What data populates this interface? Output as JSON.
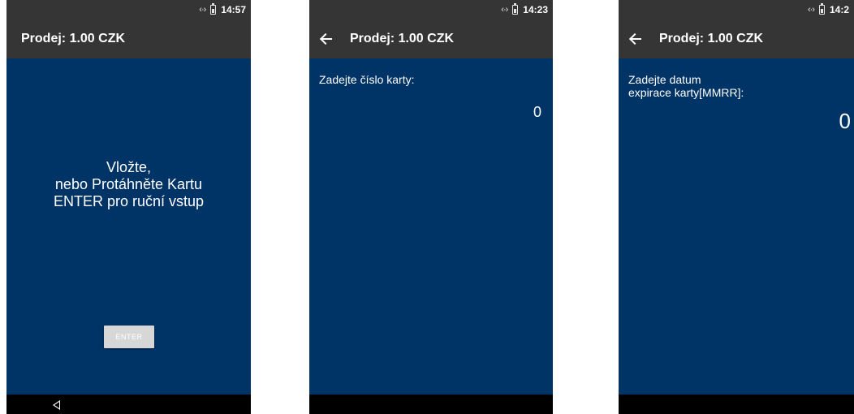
{
  "screens": [
    {
      "status": {
        "time": "14:57"
      },
      "appbar": {
        "title": "Prodej: 1.00 CZK",
        "has_back": false
      },
      "message_lines": [
        "Vložte,",
        "nebo Protáhněte Kartu",
        "ENTER pro ruční vstup"
      ],
      "enter_button_label": "ENTER"
    },
    {
      "status": {
        "time": "14:23"
      },
      "appbar": {
        "title": "Prodej: 1.00 CZK",
        "has_back": true
      },
      "field_label_lines": [
        "Zadejte číslo karty:"
      ],
      "field_value": "0"
    },
    {
      "status": {
        "time": "14:2"
      },
      "appbar": {
        "title": "Prodej: 1.00 CZK",
        "has_back": true
      },
      "field_label_lines": [
        "Zadejte datum",
        "expirace karty[MMRR]:"
      ],
      "field_value": "0"
    }
  ],
  "icons": {
    "status": [
      "sync-icon",
      "battery-icon"
    ],
    "appbar": "back-arrow-icon",
    "navbar": "nav-back-icon"
  },
  "colors": {
    "screen_background": "#003366",
    "bar_background": "#353535",
    "navbar_background": "#000000",
    "button_background": "#d7d7d7"
  }
}
